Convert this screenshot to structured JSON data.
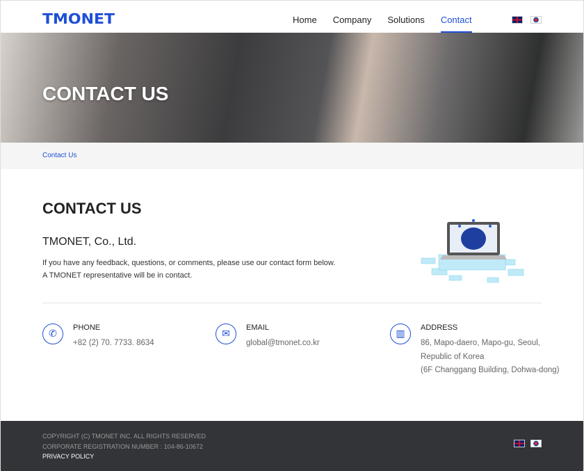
{
  "header": {
    "logo": "TMONET",
    "nav": [
      "Home",
      "Company",
      "Solutions",
      "Contact"
    ],
    "active": "Contact",
    "languages": [
      "English",
      "Korean"
    ]
  },
  "hero": {
    "title": "CONTACT US"
  },
  "breadcrumb": "Contact Us",
  "main": {
    "title": "CONTACT US",
    "company": "TMONET, Co., Ltd.",
    "desc": [
      "If you have any feedback, questions, or comments, please use our contact form below.",
      "A TMONET representative will be in contact."
    ]
  },
  "contacts": {
    "phone": {
      "label": "PHONE",
      "value": "+82 (2) 70. 7733. 8634"
    },
    "email": {
      "label": "EMAIL",
      "value": "global@tmonet.co.kr"
    },
    "address": {
      "label": "ADDRESS",
      "lines": [
        "86, Mapo-daero, Mapo-gu, Seoul,",
        "Republic of Korea",
        "(6F Changgang Building, Dohwa-dong)"
      ]
    }
  },
  "footer": {
    "copyright": "COPYRIGHT (C) TMONET INC. ALL RIGHTS RESERVED",
    "registration": "CORPORATE REGISTRATION NUMBER : 104-86-10672",
    "privacy": "PRIVACY POLICY"
  }
}
